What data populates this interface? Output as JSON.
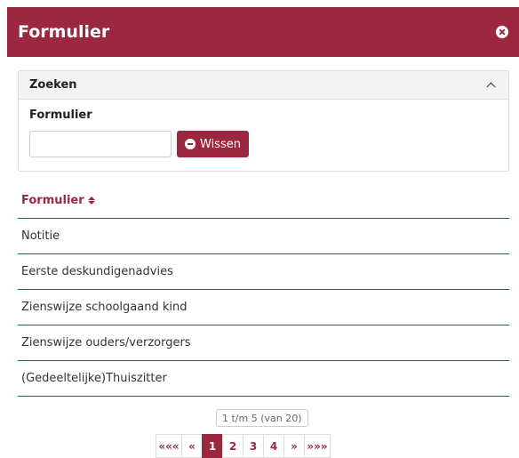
{
  "modal": {
    "title": "Formulier"
  },
  "search_panel": {
    "title": "Zoeken",
    "field_label": "Formulier",
    "input_value": "",
    "clear_label": "Wissen"
  },
  "table": {
    "column_header": "Formulier",
    "rows": [
      "Notitie",
      "Eerste deskundigenadvies",
      "Zienswijze schoolgaand kind",
      "Zienswijze ouders/verzorgers",
      "(Gedeeltelijke)Thuiszitter"
    ]
  },
  "pagination": {
    "info": "1 t/m 5 (van 20)",
    "first": "«««",
    "prev": "«",
    "pages": [
      "1",
      "2",
      "3",
      "4"
    ],
    "active_page": "1",
    "next": "»",
    "last": "»»»"
  },
  "colors": {
    "accent": "#9b2740"
  }
}
